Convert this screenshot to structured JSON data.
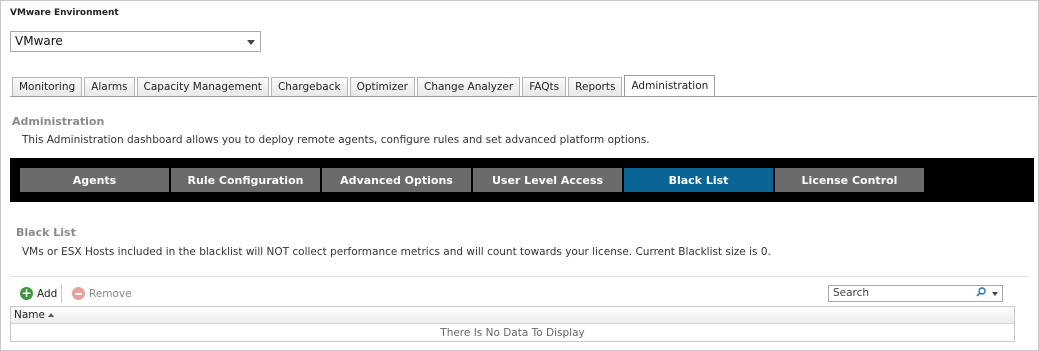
{
  "environment": {
    "title": "VMware Environment",
    "selected": "VMware"
  },
  "tabs": [
    {
      "label": "Monitoring",
      "active": false
    },
    {
      "label": "Alarms",
      "active": false
    },
    {
      "label": "Capacity Management",
      "active": false
    },
    {
      "label": "Chargeback",
      "active": false
    },
    {
      "label": "Optimizer",
      "active": false
    },
    {
      "label": "Change Analyzer",
      "active": false
    },
    {
      "label": "FAQts",
      "active": false
    },
    {
      "label": "Reports",
      "active": false
    },
    {
      "label": "Administration",
      "active": true
    }
  ],
  "admin": {
    "title": "Administration",
    "description": "This Administration dashboard allows you to deploy remote agents, configure rules and set advanced platform options."
  },
  "nav": {
    "items": [
      {
        "label": "Agents",
        "active": false
      },
      {
        "label": "Rule Configuration",
        "active": false
      },
      {
        "label": "Advanced Options",
        "active": false
      },
      {
        "label": "User Level Access",
        "active": false
      },
      {
        "label": "Black List",
        "active": true
      },
      {
        "label": "License Control",
        "active": false
      }
    ],
    "active_color": "#0a6496",
    "inactive_color": "#6b6b6b"
  },
  "blacklist": {
    "title": "Black List",
    "description": "VMs or ESX Hosts included in the blacklist will NOT collect performance metrics and will count towards your license. Current Blacklist size is 0."
  },
  "toolbar": {
    "add_label": "Add",
    "remove_label": "Remove",
    "search_placeholder": "Search"
  },
  "grid": {
    "columns": [
      "Name"
    ],
    "sort": "ascending",
    "empty_text": "There Is No Data To Display"
  }
}
